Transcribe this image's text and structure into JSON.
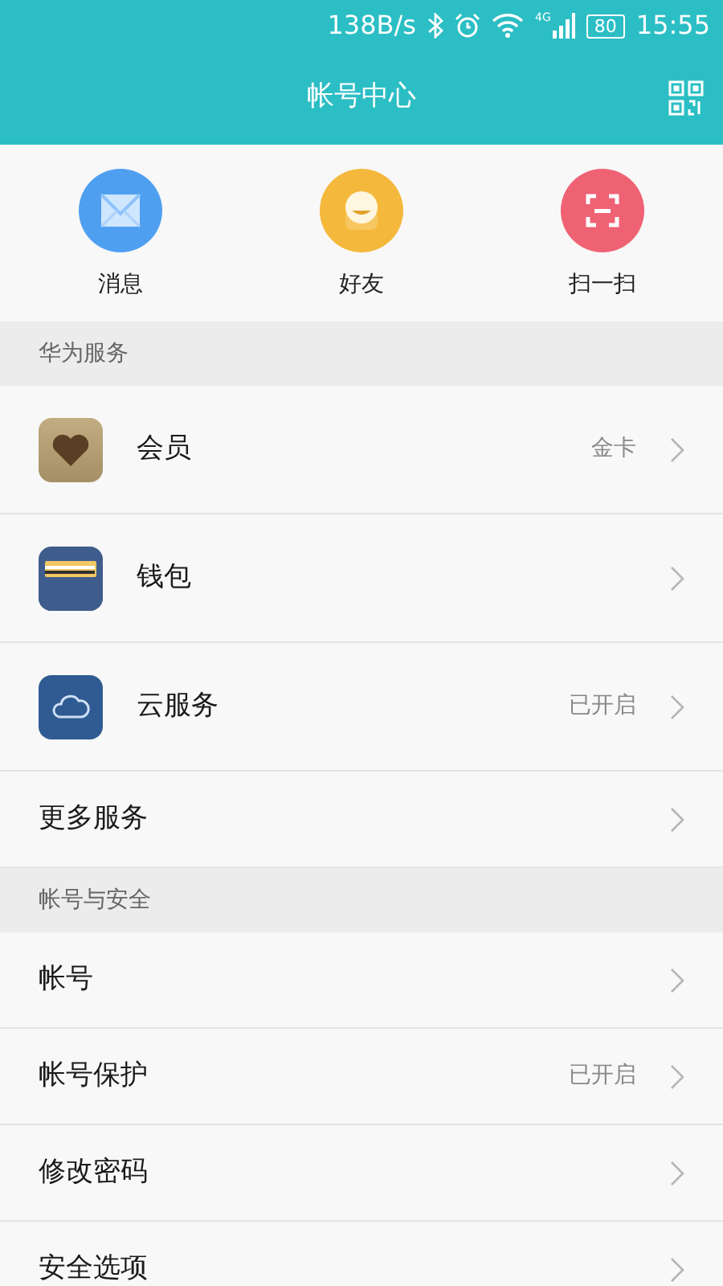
{
  "status_bar": {
    "speed": "138B/s",
    "battery": "80",
    "time": "15:55",
    "network": "4G"
  },
  "header": {
    "title": "帐号中心"
  },
  "shortcuts": [
    {
      "kind": "mail",
      "label": "消息"
    },
    {
      "kind": "friend",
      "label": "好友"
    },
    {
      "kind": "scan",
      "label": "扫一扫"
    }
  ],
  "sections": [
    {
      "title": "华为服务",
      "items": [
        {
          "kind": "heart",
          "label": "会员",
          "value": "金卡"
        },
        {
          "kind": "wallet",
          "label": "钱包"
        },
        {
          "kind": "cloud",
          "label": "云服务",
          "value": "已开启"
        },
        {
          "kind": "plain",
          "label": "更多服务"
        }
      ]
    },
    {
      "title": "帐号与安全",
      "items": [
        {
          "kind": "plain",
          "label": "帐号"
        },
        {
          "kind": "plain",
          "label": "帐号保护",
          "value": "已开启"
        },
        {
          "kind": "plain",
          "label": "修改密码"
        },
        {
          "kind": "plain",
          "label": "安全选项"
        }
      ]
    }
  ]
}
